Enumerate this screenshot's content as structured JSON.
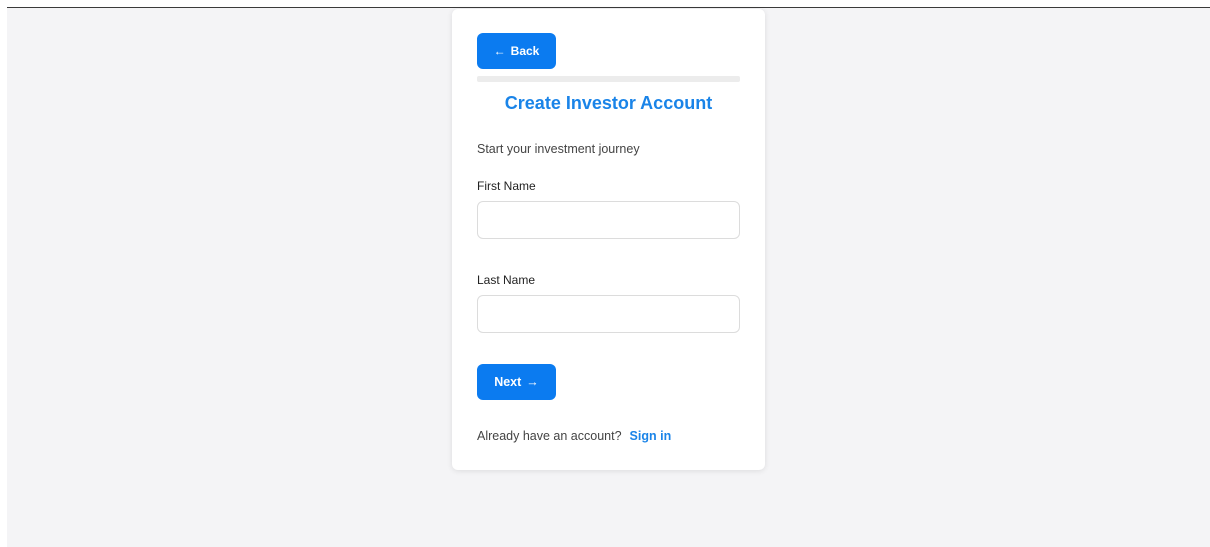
{
  "signup": {
    "back_arrow": "←",
    "back_label": "Back",
    "progress_fraction": 0.0,
    "title": "Create Investor Account",
    "subtitle": "Start your investment journey",
    "first_name": {
      "label": "First Name",
      "value": "",
      "placeholder": ""
    },
    "last_name": {
      "label": "Last Name",
      "value": "",
      "placeholder": ""
    },
    "next_label": "Next",
    "next_arrow": "→",
    "signin_prompt": "Already have an account?",
    "signin_link": "Sign in"
  },
  "colors": {
    "accent": "#0b7bf0",
    "link": "#1a84e8",
    "background": "#f4f4f6"
  },
  "icons": {
    "back": "arrow-left-icon",
    "next": "arrow-right-icon"
  }
}
